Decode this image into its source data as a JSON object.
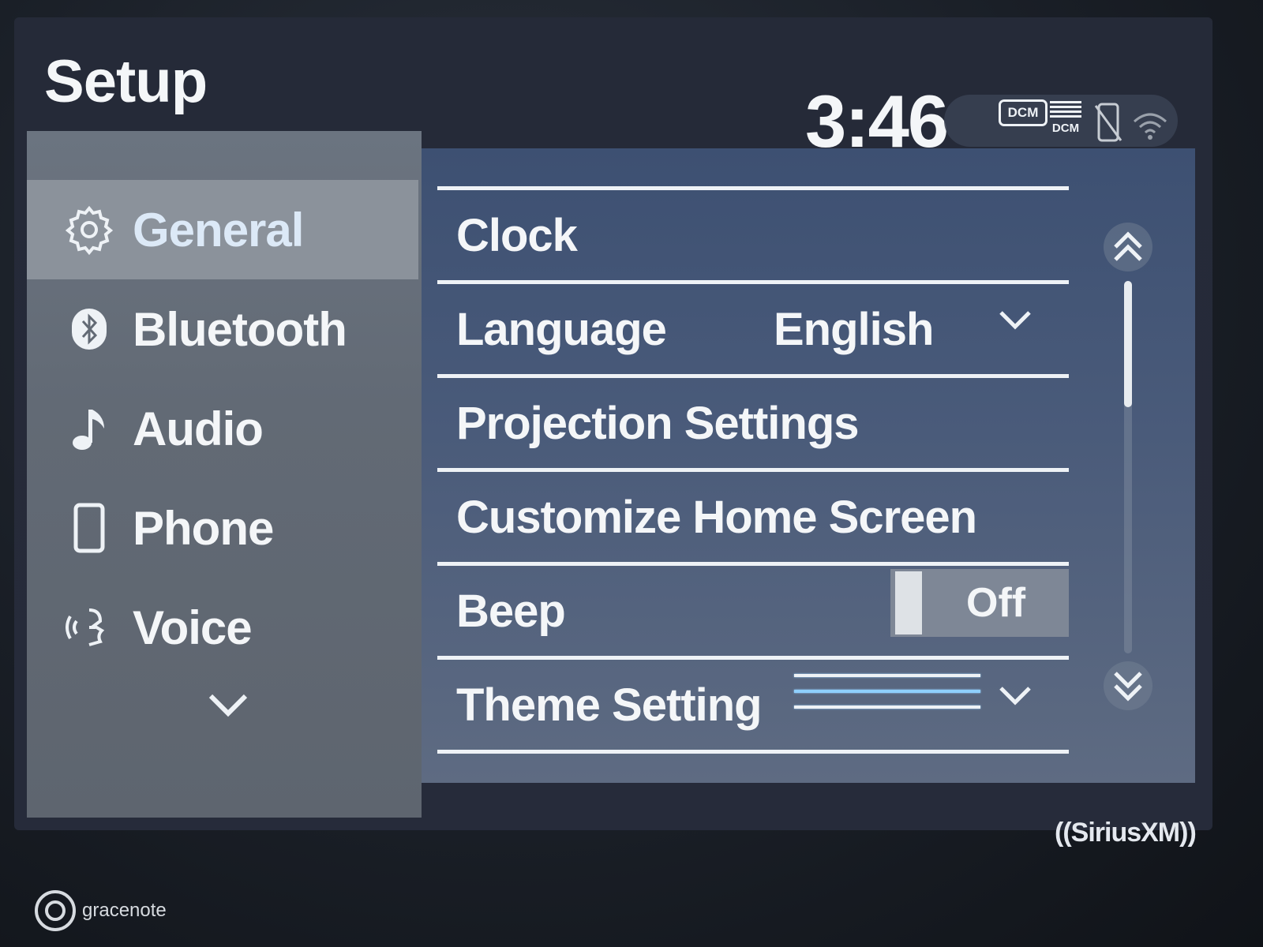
{
  "header": {
    "title": "Setup",
    "time": "3:46",
    "status": {
      "dcm_badge": "DCM",
      "dcm_signal_label": "DCM",
      "icons": [
        "dcm-badge-icon",
        "dcm-signal-icon",
        "phone-disconnected-icon",
        "wifi-icon"
      ]
    }
  },
  "sidebar": {
    "items": [
      {
        "label": "General",
        "icon": "gear-icon",
        "active": true
      },
      {
        "label": "Bluetooth",
        "icon": "bluetooth-icon",
        "active": false
      },
      {
        "label": "Audio",
        "icon": "music-note-icon",
        "active": false
      },
      {
        "label": "Phone",
        "icon": "phone-icon",
        "active": false
      },
      {
        "label": "Voice",
        "icon": "voice-icon",
        "active": false
      }
    ],
    "more_icon": "chevron-down-icon"
  },
  "settings": {
    "rows": [
      {
        "label": "Clock"
      },
      {
        "label": "Language",
        "value": "English"
      },
      {
        "label": "Projection Settings"
      },
      {
        "label": "Customize Home Screen"
      },
      {
        "label": "Beep",
        "toggle": "Off"
      },
      {
        "label": "Theme Setting"
      }
    ]
  },
  "scrollbar": {
    "position": 0.0
  },
  "footer": {
    "siriusxm": "((SiriusXM))",
    "gracenote": "gracenote"
  },
  "colors": {
    "sidebar_active": "#8b929b",
    "sidebar_bg": "#646c77",
    "main_bg": "#46577a",
    "theme_accent": "#8fd0ff"
  }
}
